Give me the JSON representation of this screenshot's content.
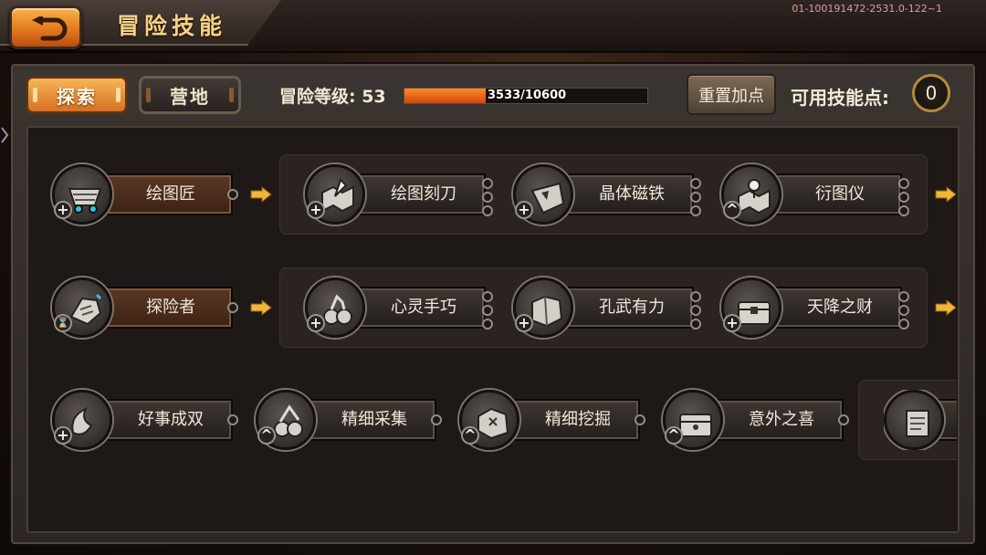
{
  "header": {
    "title": "冒险技能",
    "build_id": "01-100191472-2531.0-122~1"
  },
  "tabs": [
    {
      "label": "探索",
      "selected": true
    },
    {
      "label": "营地",
      "selected": false
    }
  ],
  "level": {
    "label": "冒险等级: 53",
    "xp_text": "3533/10600",
    "xp_current": 3533,
    "xp_max": 10600
  },
  "reset_label": "重置加点",
  "skill_points": {
    "label": "可用技能点:",
    "value": "0"
  },
  "colors": {
    "accent": "#e47a1e",
    "xp_fill": "#d2470c",
    "badge_ring": "#b48a3a"
  },
  "tree": {
    "row1": {
      "root": {
        "label": "绘图匠",
        "icon": "mine-cart-icon",
        "badge": "+"
      },
      "nodes": [
        {
          "label": "绘图刻刀",
          "icon": "map-carving-knife-icon",
          "badge": "+"
        },
        {
          "label": "晶体磁铁",
          "icon": "crystal-magnet-icon",
          "badge": "+"
        },
        {
          "label": "衍图仪",
          "icon": "map-device-icon",
          "badge": "^"
        }
      ]
    },
    "row2": {
      "root": {
        "label": "探险者",
        "icon": "explorer-glove-icon",
        "badge": "⌛"
      },
      "nodes": [
        {
          "label": "心灵手巧",
          "icon": "deft-hands-icon",
          "badge": "+"
        },
        {
          "label": "孔武有力",
          "icon": "strength-rock-icon",
          "badge": "+"
        },
        {
          "label": "天降之财",
          "icon": "treasure-chest-icon",
          "badge": "+"
        }
      ]
    },
    "row3": {
      "nodes": [
        {
          "label": "好事成双",
          "icon": "double-luck-icon",
          "badge": "+"
        },
        {
          "label": "精细采集",
          "icon": "fine-gather-icon",
          "badge": "^"
        },
        {
          "label": "精细挖掘",
          "icon": "fine-dig-icon",
          "badge": "^"
        },
        {
          "label": "意外之喜",
          "icon": "surprise-chest-icon",
          "badge": "^"
        }
      ],
      "partial": {
        "icon": "scroll-map-icon"
      }
    }
  }
}
